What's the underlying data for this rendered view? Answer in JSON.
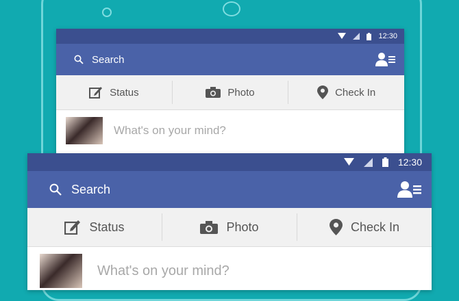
{
  "status_bar": {
    "time": "12:30",
    "icons": [
      "wifi-icon",
      "signal-icon",
      "battery-icon"
    ]
  },
  "search": {
    "label": "Search",
    "icon": "search-icon"
  },
  "friend_requests": {
    "icon": "friend-requests-icon"
  },
  "actions": [
    {
      "label": "Status",
      "icon": "edit-icon"
    },
    {
      "label": "Photo",
      "icon": "camera-icon"
    },
    {
      "label": "Check In",
      "icon": "location-pin-icon"
    }
  ],
  "composer": {
    "placeholder": "What's on your mind?"
  },
  "colors": {
    "background": "#11aab0",
    "status_bar": "#3b4f8f",
    "app_bar": "#4a62a8",
    "action_bar": "#f1f1f1"
  }
}
